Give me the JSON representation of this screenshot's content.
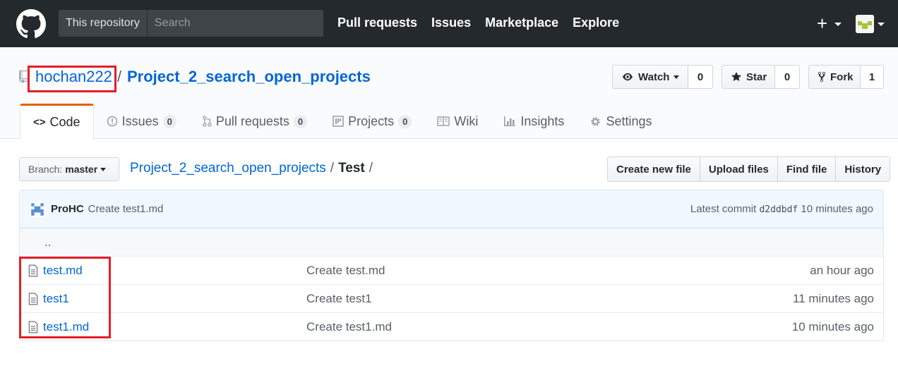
{
  "header": {
    "scope_label": "This repository",
    "search_placeholder": "Search",
    "nav": [
      "Pull requests",
      "Issues",
      "Marketplace",
      "Explore"
    ],
    "plus": "+"
  },
  "repo": {
    "owner": "hochan222",
    "separator": "/",
    "name": "Project_2_search_open_projects",
    "watch_label": "Watch",
    "watch_count": "0",
    "star_label": "Star",
    "star_count": "0",
    "fork_label": "Fork",
    "fork_count": "1"
  },
  "tabs": [
    {
      "label": "Code",
      "icon": "code-icon"
    },
    {
      "label": "Issues",
      "count": "0",
      "icon": "issue-icon"
    },
    {
      "label": "Pull requests",
      "count": "0",
      "icon": "pull-request-icon"
    },
    {
      "label": "Projects",
      "count": "0",
      "icon": "project-icon"
    },
    {
      "label": "Wiki",
      "icon": "book-icon"
    },
    {
      "label": "Insights",
      "icon": "graph-icon"
    },
    {
      "label": "Settings",
      "icon": "gear-icon"
    }
  ],
  "filenav": {
    "branch_prefix": "Branch:",
    "branch": "master",
    "crumb_repo": "Project_2_search_open_projects",
    "crumb_sep": "/",
    "crumb_dir": "Test",
    "crumb_trail": "/",
    "buttons": [
      "Create new file",
      "Upload files",
      "Find file",
      "History"
    ]
  },
  "commit": {
    "author": "ProHC",
    "message": "Create test1.md",
    "latest_label": "Latest commit",
    "sha": "d2ddbdf",
    "age": "10 minutes ago"
  },
  "parent_dir": "..",
  "files": [
    {
      "name": "test.md",
      "message": "Create test.md",
      "age": "an hour ago"
    },
    {
      "name": "test1",
      "message": "Create test1",
      "age": "11 minutes ago"
    },
    {
      "name": "test1.md",
      "message": "Create test1.md",
      "age": "10 minutes ago"
    }
  ],
  "colors": {
    "header_bg": "#24292e",
    "link": "#0366d6",
    "highlight_box": "#e41e26",
    "tab_accent": "#e36209"
  }
}
